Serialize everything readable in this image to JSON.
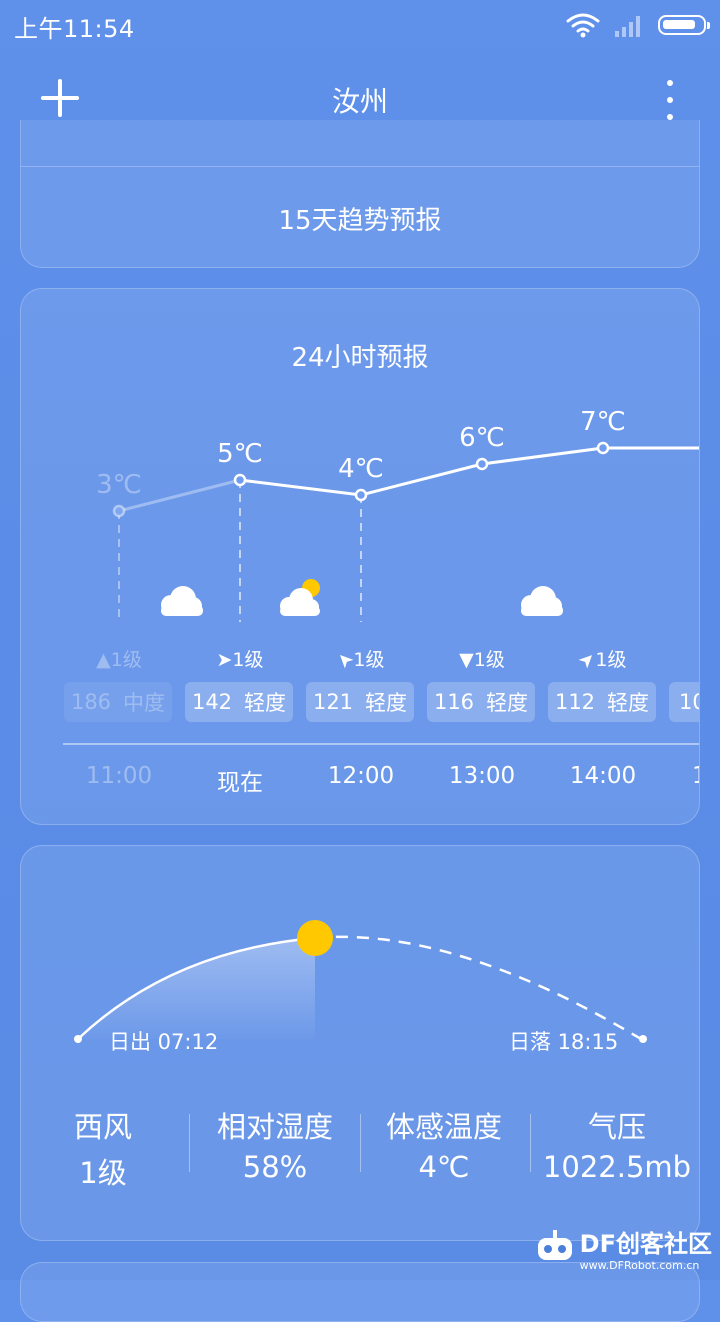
{
  "status": {
    "time": "上午11:54",
    "icons": [
      "wifi-icon",
      "signal-icon",
      "battery-icon"
    ]
  },
  "header": {
    "city": "汝州",
    "add_icon": "plus-icon",
    "more_icon": "more-vertical-icon"
  },
  "trend_card": {
    "label": "15天趋势预报"
  },
  "hourly_card": {
    "title": "24小时预报",
    "temps": [
      "3℃",
      "5℃",
      "4℃",
      "6℃",
      "7℃"
    ],
    "winds": [
      "1级",
      "1级",
      "1级",
      "1级",
      "1级"
    ],
    "aqi": [
      {
        "value": "186",
        "level": "中度"
      },
      {
        "value": "142",
        "level": "轻度"
      },
      {
        "value": "121",
        "level": "轻度"
      },
      {
        "value": "116",
        "level": "轻度"
      },
      {
        "value": "112",
        "level": "轻度"
      },
      {
        "value": "10"
      }
    ],
    "times": [
      "11:00",
      "现在",
      "12:00",
      "13:00",
      "14:00",
      "1"
    ],
    "weather_icons": [
      "cloudy-icon",
      "partly-sunny-icon",
      "cloudy-icon"
    ],
    "colors": {
      "accent_sun": "#ffc800"
    }
  },
  "sun_card": {
    "sunrise": "日出 07:12",
    "sunset": "日落 18:15",
    "details": [
      {
        "label": "西风",
        "value": "1级"
      },
      {
        "label": "相对湿度",
        "value": "58%"
      },
      {
        "label": "体感温度",
        "value": "4℃"
      },
      {
        "label": "气压",
        "value": "1022.5mb"
      }
    ]
  },
  "watermark": {
    "brand": "DF创客社区",
    "url": "www.DFRobot.com.cn"
  }
}
